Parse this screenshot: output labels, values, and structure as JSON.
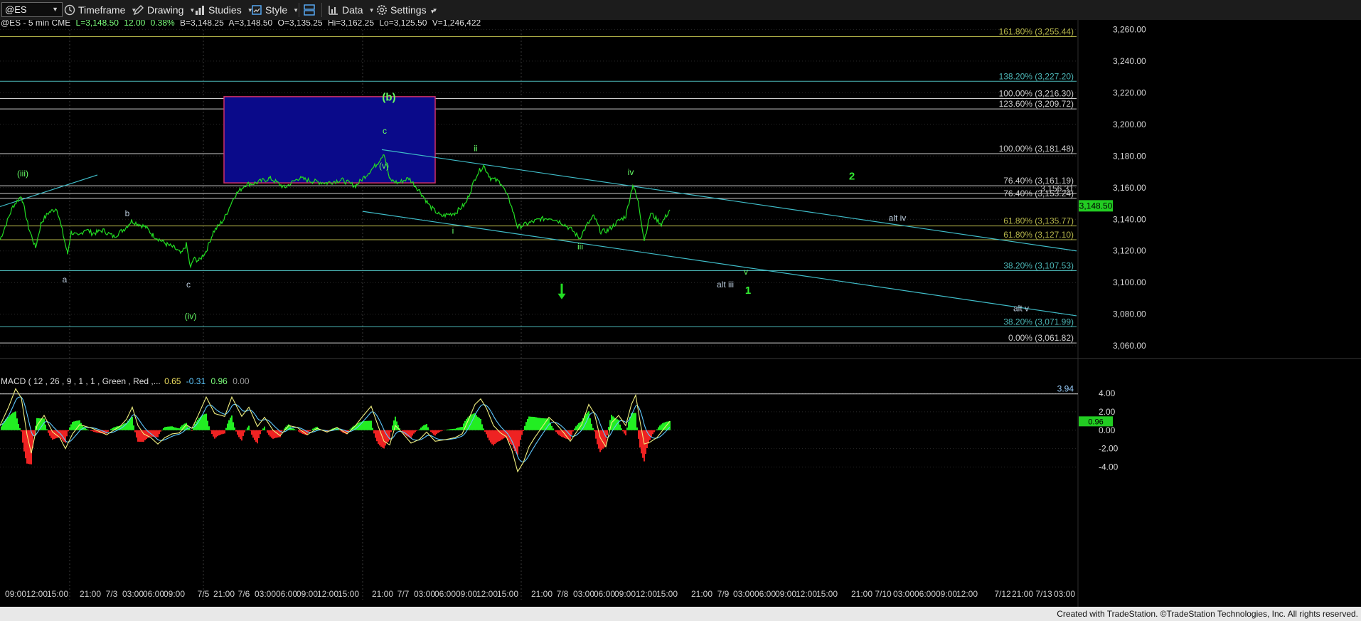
{
  "toolbar": {
    "symbol": "@ES",
    "timeframe_label": "Timeframe",
    "drawing_label": "Drawing",
    "studies_label": "Studies",
    "style_label": "Style",
    "data_label": "Data",
    "settings_label": "Settings"
  },
  "footer": {
    "credit": "Created with TradeStation. ©TradeStation Technologies, Inc. All rights reserved."
  },
  "chart_data": [
    {
      "type": "line",
      "title": "",
      "header": {
        "symbol": "@ES - 5 min  CME",
        "last": "L=3,148.50",
        "change": "12.00",
        "pct": "0.38%",
        "bid": "B=3,148.25",
        "ask": "A=3,148.50",
        "open": "O=3,135.25",
        "high": "Hi=3,162.25",
        "low": "Lo=3,125.50",
        "volume": "V=1,246,422"
      },
      "ylim": [
        3052,
        3266
      ],
      "y_ticks": [
        3060,
        3080,
        3100,
        3120,
        3140,
        3160,
        3180,
        3200,
        3220,
        3240,
        3260
      ],
      "y_tick_labels": [
        "3,060.00",
        "3,080.00",
        "3,100.00",
        "3,120.00",
        "3,140.00",
        "3,160.00",
        "3,180.00",
        "3,200.00",
        "3,220.00",
        "3,240.00",
        "3,260.00"
      ],
      "last_price": 3148.5,
      "last_price_label": "3,148.50",
      "line_color": "#22dd22",
      "price_path": [
        [
          0,
          3127
        ],
        [
          18,
          3148
        ],
        [
          30,
          3155
        ],
        [
          40,
          3135
        ],
        [
          50,
          3122
        ],
        [
          58,
          3138
        ],
        [
          68,
          3144
        ],
        [
          80,
          3147
        ],
        [
          90,
          3128
        ],
        [
          95,
          3118
        ],
        [
          100,
          3132
        ],
        [
          110,
          3129
        ],
        [
          120,
          3134
        ],
        [
          130,
          3131
        ],
        [
          145,
          3133
        ],
        [
          160,
          3129
        ],
        [
          175,
          3134
        ],
        [
          185,
          3139
        ],
        [
          195,
          3137
        ],
        [
          205,
          3135
        ],
        [
          215,
          3130
        ],
        [
          225,
          3127
        ],
        [
          235,
          3124
        ],
        [
          245,
          3122
        ],
        [
          255,
          3118
        ],
        [
          262,
          3124
        ],
        [
          268,
          3109
        ],
        [
          272,
          3115
        ],
        [
          280,
          3114
        ],
        [
          290,
          3120
        ],
        [
          300,
          3132
        ],
        [
          315,
          3140
        ],
        [
          330,
          3155
        ],
        [
          345,
          3162
        ],
        [
          360,
          3163
        ],
        [
          380,
          3166
        ],
        [
          400,
          3160
        ],
        [
          420,
          3166
        ],
        [
          440,
          3164
        ],
        [
          460,
          3163
        ],
        [
          480,
          3165
        ],
        [
          500,
          3161
        ],
        [
          515,
          3168
        ],
        [
          530,
          3175
        ],
        [
          540,
          3182
        ],
        [
          548,
          3165
        ],
        [
          560,
          3163
        ],
        [
          575,
          3166
        ],
        [
          590,
          3158
        ],
        [
          605,
          3148
        ],
        [
          620,
          3142
        ],
        [
          640,
          3144
        ],
        [
          655,
          3150
        ],
        [
          670,
          3168
        ],
        [
          680,
          3174
        ],
        [
          690,
          3166
        ],
        [
          705,
          3163
        ],
        [
          718,
          3150
        ],
        [
          728,
          3135
        ],
        [
          740,
          3137
        ],
        [
          760,
          3140
        ],
        [
          775,
          3141
        ],
        [
          790,
          3138
        ],
        [
          805,
          3133
        ],
        [
          815,
          3128
        ],
        [
          825,
          3136
        ],
        [
          835,
          3142
        ],
        [
          845,
          3132
        ],
        [
          855,
          3133
        ],
        [
          870,
          3139
        ],
        [
          880,
          3142
        ],
        [
          890,
          3162
        ],
        [
          898,
          3150
        ],
        [
          906,
          3127
        ],
        [
          915,
          3144
        ],
        [
          930,
          3137
        ],
        [
          942,
          3146
        ]
      ],
      "fib_levels": [
        {
          "label": "161.80% (3,255.44)",
          "value": 3255.44,
          "color": "#b5b54a"
        },
        {
          "label": "138.20% (3,227.20)",
          "value": 3227.2,
          "color": "#4bb5b5"
        },
        {
          "label": "100.00% (3,216.30)",
          "value": 3216.3,
          "color": "#cccccc"
        },
        {
          "label": "123.60% (3,209.72)",
          "value": 3209.72,
          "color": "#cccccc"
        },
        {
          "label": "100.00% (3,181.48)",
          "value": 3181.48,
          "color": "#cccccc"
        },
        {
          "label": "76.40% (3,161.19)",
          "value": 3161.19,
          "color": "#cccccc"
        },
        {
          "label": "3,156.31",
          "value": 3156.31,
          "color": "#cccccc"
        },
        {
          "label": "76.40% (3,153.24)",
          "value": 3153.24,
          "color": "#cccccc"
        },
        {
          "label": "61.80% (3,135.77)",
          "value": 3135.77,
          "color": "#b5b54a"
        },
        {
          "label": "61.80% (3,127.10)",
          "value": 3127.1,
          "color": "#b5b54a"
        },
        {
          "label": "38.20% (3,107.53)",
          "value": 3107.53,
          "color": "#4bb5b5"
        },
        {
          "label": "38.20% (3,071.99)",
          "value": 3071.99,
          "color": "#4bb5b5"
        },
        {
          "label": "0.00% (3,061.82)",
          "value": 3061.82,
          "color": "#cccccc"
        }
      ],
      "box": {
        "x0": 315,
        "x1": 612,
        "y0": 3163,
        "y1": 3217.5,
        "fill": "#0a0a8a",
        "border": "#d0306a"
      },
      "trend_lines": [
        {
          "x0": 0,
          "y0": 3148,
          "x1": 137,
          "y1": 3168
        },
        {
          "x0": 537,
          "y0": 3184,
          "x1": 1514,
          "y1": 3120
        },
        {
          "x0": 510,
          "y0": 3145,
          "x1": 1514,
          "y1": 3079
        }
      ],
      "wave_labels": [
        {
          "text": "(iii)",
          "x": 32,
          "y": 3167,
          "color": "#66ff66"
        },
        {
          "text": "a",
          "x": 91,
          "y": 3100,
          "color": "#bbccdd"
        },
        {
          "text": "b",
          "x": 179,
          "y": 3142,
          "color": "#bbccdd"
        },
        {
          "text": "c",
          "x": 265,
          "y": 3097,
          "color": "#bbccdd"
        },
        {
          "text": "(iv)",
          "x": 268,
          "y": 3077,
          "color": "#66ff66"
        },
        {
          "text": "(b)",
          "x": 547,
          "y": 3215,
          "color": "#66ff66",
          "bold": true
        },
        {
          "text": "c",
          "x": 541,
          "y": 3194,
          "color": "#66ff66"
        },
        {
          "text": "(v)",
          "x": 540,
          "y": 3172,
          "color": "#66ff66"
        },
        {
          "text": "ii",
          "x": 669,
          "y": 3183,
          "color": "#66ff66"
        },
        {
          "text": "i",
          "x": 637,
          "y": 3131,
          "color": "#66ff66"
        },
        {
          "text": "iii",
          "x": 816,
          "y": 3121,
          "color": "#66ff66"
        },
        {
          "text": "iv",
          "x": 887,
          "y": 3168,
          "color": "#66ff66"
        },
        {
          "text": "v",
          "x": 1049,
          "y": 3105,
          "color": "#66ff66"
        },
        {
          "text": "1",
          "x": 1052,
          "y": 3093,
          "color": "#33ee33",
          "bold": true
        },
        {
          "text": "alt iii",
          "x": 1020,
          "y": 3097,
          "color": "#bbccdd"
        },
        {
          "text": "2",
          "x": 1198,
          "y": 3165,
          "color": "#33ee33",
          "bold": true
        },
        {
          "text": "alt iv",
          "x": 1262,
          "y": 3139,
          "color": "#bbccdd"
        },
        {
          "text": "alt v",
          "x": 1436,
          "y": 3082,
          "color": "#bbccdd"
        }
      ],
      "down_arrow": {
        "x": 790,
        "y": 3093,
        "color": "#22dd22"
      }
    },
    {
      "type": "line",
      "title": "",
      "header": {
        "label": "MACD ( 12 , 26 , 9 , 1 , 1 , Green , Red ,... ",
        "v1": "0.65",
        "v2": "-0.31",
        "v3": "0.96",
        "v4": "0.00"
      },
      "ylim": [
        -5.5,
        5
      ],
      "y_ticks": [
        4,
        2,
        0,
        -2,
        -4
      ],
      "y_tick_labels": [
        "4.00",
        "2.00",
        "0.00",
        "-2.00",
        "-4.00"
      ],
      "ref_line": {
        "value": 3.94,
        "label": "3.94"
      },
      "last_value": 0.96,
      "last_value_label": "0.96",
      "macd_path": [
        [
          0,
          0.5
        ],
        [
          12,
          2.5
        ],
        [
          22,
          4.5
        ],
        [
          30,
          3.5
        ],
        [
          38,
          -0.5
        ],
        [
          44,
          -2.5
        ],
        [
          52,
          0.5
        ],
        [
          62,
          1.6
        ],
        [
          74,
          -0.2
        ],
        [
          84,
          -0.8
        ],
        [
          92,
          -2.0
        ],
        [
          102,
          -0.4
        ],
        [
          112,
          0.6
        ],
        [
          130,
          0.2
        ],
        [
          150,
          -0.5
        ],
        [
          170,
          0.5
        ],
        [
          178,
          1.2
        ],
        [
          186,
          2.5
        ],
        [
          194,
          0.5
        ],
        [
          202,
          -0.4
        ],
        [
          212,
          -0.8
        ],
        [
          222,
          -1.5
        ],
        [
          232,
          -0.8
        ],
        [
          242,
          -0.4
        ],
        [
          252,
          -0.3
        ],
        [
          262,
          0.6
        ],
        [
          270,
          0.2
        ],
        [
          278,
          1.5
        ],
        [
          290,
          3.6
        ],
        [
          302,
          1.8
        ],
        [
          316,
          1.5
        ],
        [
          326,
          3.6
        ],
        [
          340,
          1.5
        ],
        [
          350,
          2.5
        ],
        [
          362,
          0.4
        ],
        [
          372,
          1.4
        ],
        [
          384,
          0.0
        ],
        [
          394,
          -0.6
        ],
        [
          406,
          0.5
        ],
        [
          418,
          0.3
        ],
        [
          432,
          -0.5
        ],
        [
          446,
          0.2
        ],
        [
          460,
          -0.2
        ],
        [
          474,
          0.3
        ],
        [
          488,
          -0.4
        ],
        [
          500,
          0.5
        ],
        [
          510,
          1.5
        ],
        [
          522,
          2.6
        ],
        [
          532,
          0.4
        ],
        [
          540,
          -1.2
        ],
        [
          548,
          -1.6
        ],
        [
          556,
          0.5
        ],
        [
          566,
          -0.3
        ],
        [
          578,
          -1.4
        ],
        [
          590,
          -1.0
        ],
        [
          600,
          -0.2
        ],
        [
          612,
          -1.2
        ],
        [
          628,
          -1.0
        ],
        [
          640,
          -0.8
        ],
        [
          650,
          -0.4
        ],
        [
          658,
          1.0
        ],
        [
          668,
          2.8
        ],
        [
          676,
          3.4
        ],
        [
          684,
          2.4
        ],
        [
          694,
          0.5
        ],
        [
          704,
          -0.3
        ],
        [
          712,
          -0.7
        ],
        [
          720,
          -2.2
        ],
        [
          728,
          -4.5
        ],
        [
          736,
          -3.5
        ],
        [
          744,
          -1.8
        ],
        [
          752,
          -0.8
        ],
        [
          762,
          0.3
        ],
        [
          772,
          1.4
        ],
        [
          782,
          0.7
        ],
        [
          792,
          -0.2
        ],
        [
          802,
          -1.2
        ],
        [
          810,
          -0.3
        ],
        [
          818,
          0.6
        ],
        [
          828,
          2.8
        ],
        [
          836,
          1.8
        ],
        [
          844,
          -0.8
        ],
        [
          852,
          -1.8
        ],
        [
          860,
          0.8
        ],
        [
          870,
          1.6
        ],
        [
          880,
          0.5
        ],
        [
          888,
          2.8
        ],
        [
          894,
          3.8
        ],
        [
          900,
          1.0
        ],
        [
          906,
          -1.5
        ],
        [
          914,
          -1.3
        ],
        [
          924,
          -0.8
        ],
        [
          934,
          0.2
        ],
        [
          942,
          0.96
        ]
      ]
    }
  ],
  "x_axis": {
    "tick_labels": [
      {
        "x": 22,
        "text": "09:00"
      },
      {
        "x": 52,
        "text": "12:00"
      },
      {
        "x": 81,
        "text": "15:00"
      },
      {
        "x": 127,
        "text": "21:00"
      },
      {
        "x": 157,
        "text": "7/3"
      },
      {
        "x": 187,
        "text": "03:00"
      },
      {
        "x": 216,
        "text": "06:00"
      },
      {
        "x": 245,
        "text": "09:00"
      },
      {
        "x": 286,
        "text": "7/5"
      },
      {
        "x": 315,
        "text": "21:00"
      },
      {
        "x": 343,
        "text": "7/6"
      },
      {
        "x": 373,
        "text": "03:00"
      },
      {
        "x": 403,
        "text": "06:00"
      },
      {
        "x": 432,
        "text": "09:00"
      },
      {
        "x": 461,
        "text": "12:00"
      },
      {
        "x": 490,
        "text": "15:00"
      },
      {
        "x": 538,
        "text": "21:00"
      },
      {
        "x": 567,
        "text": "7/7"
      },
      {
        "x": 597,
        "text": "03:00"
      },
      {
        "x": 626,
        "text": "06:00"
      },
      {
        "x": 656,
        "text": "09:00"
      },
      {
        "x": 685,
        "text": "12:00"
      },
      {
        "x": 714,
        "text": "15:00"
      },
      {
        "x": 762,
        "text": "21:00"
      },
      {
        "x": 791,
        "text": "7/8"
      },
      {
        "x": 821,
        "text": "03:00"
      },
      {
        "x": 850,
        "text": "06:00"
      },
      {
        "x": 879,
        "text": "09:00"
      },
      {
        "x": 909,
        "text": "12:00"
      },
      {
        "x": 938,
        "text": "15:00"
      },
      {
        "x": 987,
        "text": "21:00"
      },
      {
        "x": 1017,
        "text": "7/9"
      },
      {
        "x": 1046,
        "text": "03:00"
      },
      {
        "x": 1076,
        "text": "06:00"
      },
      {
        "x": 1105,
        "text": "09:00"
      },
      {
        "x": 1134,
        "text": "12:00"
      },
      {
        "x": 1163,
        "text": "15:00"
      },
      {
        "x": 1212,
        "text": "21:00"
      },
      {
        "x": 1242,
        "text": "7/10"
      },
      {
        "x": 1271,
        "text": "03:00"
      },
      {
        "x": 1301,
        "text": "06:00"
      },
      {
        "x": 1331,
        "text": "09:00"
      },
      {
        "x": 1360,
        "text": "12:00"
      },
      {
        "x": 1410,
        "text": "7/12"
      },
      {
        "x": 1438,
        "text": "21:00"
      },
      {
        "x": 1468,
        "text": "7/13"
      },
      {
        "x": 1497,
        "text": "03:00"
      }
    ],
    "dotted_verticals": [
      98,
      286,
      510,
      733
    ]
  },
  "colors": {
    "background": "#000000",
    "grid": "#2a2a2a",
    "axis_bg": "#111111",
    "price_tag": "#22cc22",
    "macd_fast": "#f0f080",
    "macd_slow": "#5ec8ff",
    "hist_pos": "#22ee22",
    "hist_neg": "#ee2222"
  }
}
